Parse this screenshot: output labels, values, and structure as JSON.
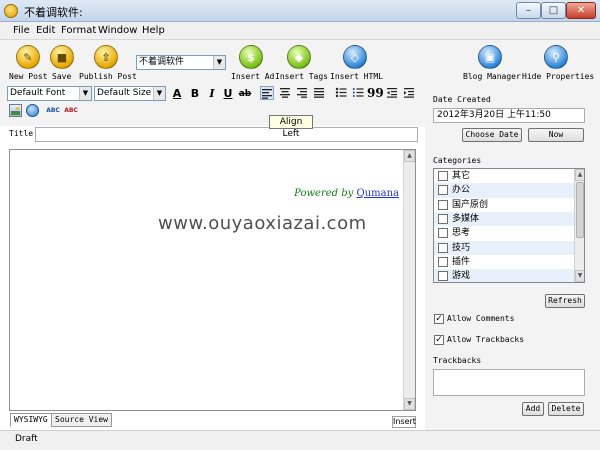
{
  "window": {
    "title": "不着调软件:"
  },
  "menu": {
    "items": [
      "File",
      "Edit",
      "Format",
      "Window",
      "Help"
    ]
  },
  "toolbar": {
    "new_post": "New Post",
    "save": "Save",
    "publish_post": "Publish Post",
    "blog_select": "不着调软件",
    "insert_ad": "Insert Ad",
    "insert_tags": "Insert Tags",
    "insert_html": "Insert HTML",
    "blog_manager": "Blog Manager",
    "hide_properties": "Hide Properties"
  },
  "format": {
    "default_font": "Default Font",
    "default_size": "Default Size",
    "text_color_glyph": "A",
    "bold_glyph": "B",
    "italic_glyph": "I",
    "underline_glyph": "U",
    "strike_glyph": "ab",
    "quote_glyph": "99",
    "spell_glyph": "ABC",
    "tooltip": "Align Left"
  },
  "post": {
    "title_label": "Title:",
    "title_value": ""
  },
  "editor": {
    "powered_by": "Powered by",
    "qumana_link": "Qumana",
    "tab_wysiwyg": "WYSIWYG",
    "tab_source": "Source View",
    "insert_mode": "Insert"
  },
  "status": {
    "text": "Draft"
  },
  "properties": {
    "date_created_label": "Date Created",
    "date_value": "2012年3月20日 上午11:50",
    "choose_date": "Choose Date",
    "now": "Now",
    "categories_label": "Categories",
    "categories": [
      "其它",
      "办公",
      "国产原创",
      "多媒体",
      "思考",
      "技巧",
      "插件",
      "游戏"
    ],
    "refresh": "Refresh",
    "allow_comments": "Allow Comments",
    "allow_trackbacks": "Allow Trackbacks",
    "allow_comments_checked": true,
    "allow_trackbacks_checked": true,
    "trackbacks_label": "Trackbacks",
    "add": "Add",
    "delete": "Delete"
  },
  "watermark": "www.ouyaoxiazai.com"
}
